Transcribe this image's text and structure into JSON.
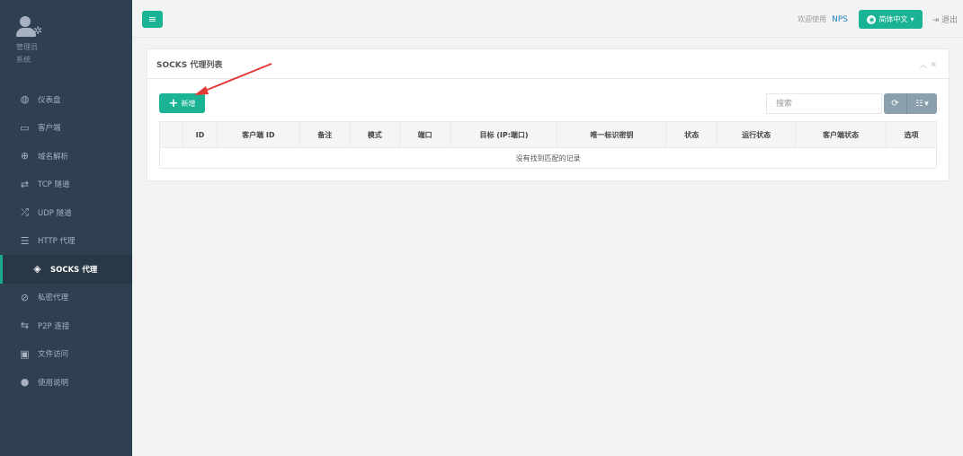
{
  "sidebar": {
    "profile_role_1": "管理员",
    "profile_role_2": "系统",
    "items": [
      {
        "label": "仪表盘",
        "icon": "dashboard-icon",
        "glyph": "◍"
      },
      {
        "label": "客户端",
        "icon": "desktop-icon",
        "glyph": "▭"
      },
      {
        "label": "域名解析",
        "icon": "globe-icon",
        "glyph": "⊕"
      },
      {
        "label": "TCP 隧道",
        "icon": "retweet-icon",
        "glyph": "⇄"
      },
      {
        "label": "UDP 隧道",
        "icon": "random-icon",
        "glyph": "⤮"
      },
      {
        "label": "HTTP 代理",
        "icon": "server-icon",
        "glyph": "☰"
      },
      {
        "label": "SOCKS 代理",
        "icon": "layers-icon",
        "glyph": "◈",
        "active": true
      },
      {
        "label": "私密代理",
        "icon": "eye-slash-icon",
        "glyph": "⊘"
      },
      {
        "label": "P2P 连接",
        "icon": "exchange-icon",
        "glyph": "⇆"
      },
      {
        "label": "文件访问",
        "icon": "briefcase-icon",
        "glyph": "▣"
      },
      {
        "label": "使用说明",
        "icon": "lightbulb-icon",
        "glyph": "●"
      }
    ]
  },
  "topbar": {
    "welcome": "欢迎使用",
    "brand": "NPS",
    "language": "简体中文",
    "logout": "退出"
  },
  "panel": {
    "title": "SOCKS 代理列表",
    "add_label": "新增",
    "search_placeholder": "搜索",
    "columns": [
      "",
      "ID",
      "客户端 ID",
      "备注",
      "模式",
      "端口",
      "目标 (IP:端口)",
      "唯一标识密钥",
      "状态",
      "运行状态",
      "客户端状态",
      "选项"
    ],
    "empty_message": "没有找到匹配的记录"
  },
  "colors": {
    "sidebar_bg": "#2f4050",
    "accent": "#1ab394",
    "arrow": "#e53935"
  }
}
